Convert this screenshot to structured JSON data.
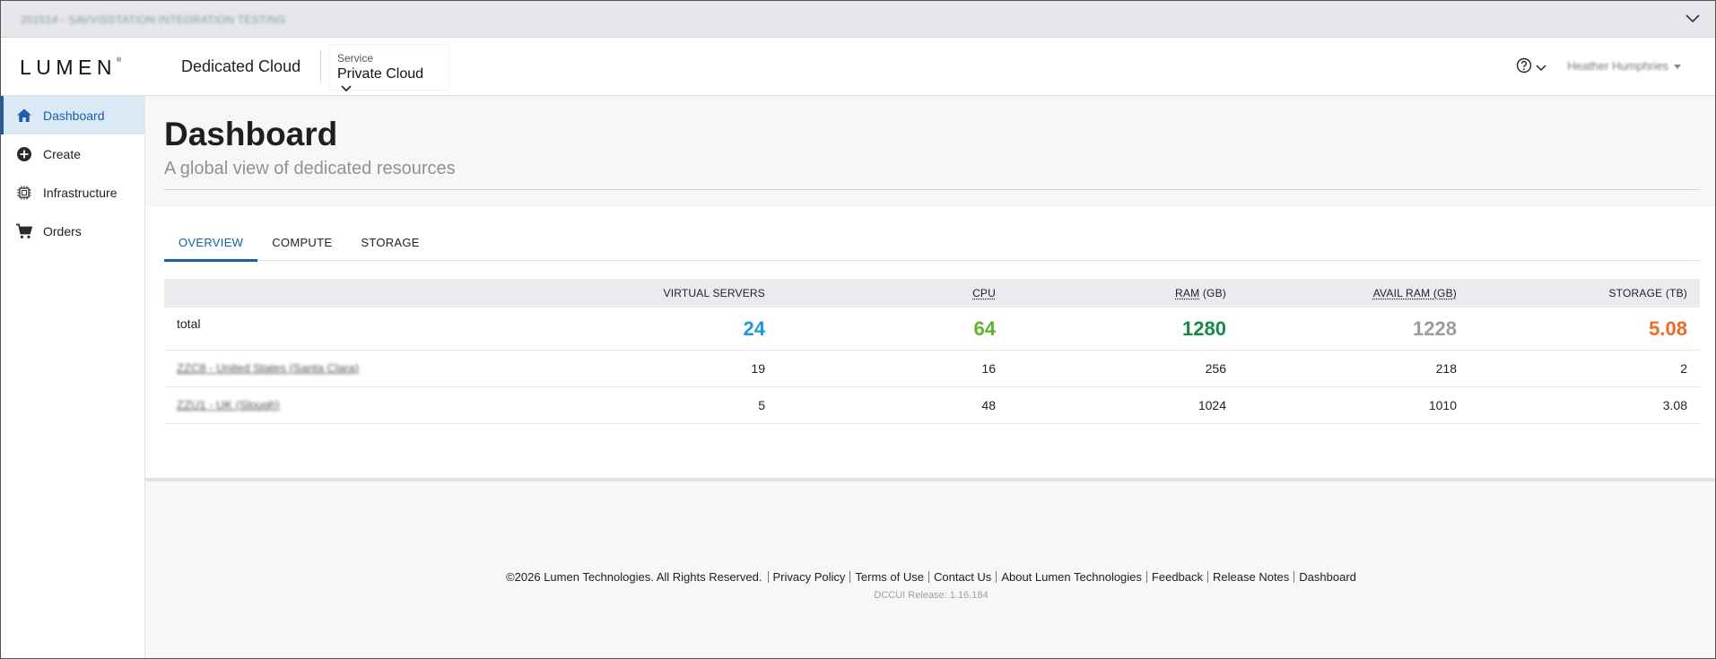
{
  "account_bar": {
    "account_name": "201514 - SAVVISSTATION INTEGRATION TESTING"
  },
  "header": {
    "logo": "LUMEN",
    "logo_mark": "®",
    "product": "Dedicated Cloud",
    "service_label": "Service",
    "service_value": "Private Cloud",
    "user_name": "Heather Humphries"
  },
  "sidebar": {
    "items": [
      {
        "label": "Dashboard",
        "icon": "home-icon",
        "active": true
      },
      {
        "label": "Create",
        "icon": "plus-circle-icon",
        "active": false
      },
      {
        "label": "Infrastructure",
        "icon": "chip-icon",
        "active": false
      },
      {
        "label": "Orders",
        "icon": "cart-icon",
        "active": false
      }
    ]
  },
  "page": {
    "title": "Dashboard",
    "subtitle": "A global view of dedicated resources"
  },
  "tabs": [
    {
      "label": "OVERVIEW",
      "active": true
    },
    {
      "label": "COMPUTE",
      "active": false
    },
    {
      "label": "STORAGE",
      "active": false
    }
  ],
  "table": {
    "headers": {
      "virtual_servers": "VIRTUAL SERVERS",
      "cpu": "CPU",
      "ram_abbr": "RAM",
      "ram_unit": "(GB)",
      "avail_ram_abbr": "AVAIL RAM (GB)",
      "storage": "STORAGE (TB)"
    },
    "total": {
      "label": "total",
      "virtual_servers": "24",
      "cpu": "64",
      "ram": "1280",
      "avail_ram": "1228",
      "storage": "5.08"
    },
    "rows": [
      {
        "site": "ZZC8 - United States (Santa Clara)",
        "virtual_servers": "19",
        "cpu": "16",
        "ram": "256",
        "avail_ram": "218",
        "storage": "2"
      },
      {
        "site": "ZZU1 - UK (Slough)",
        "virtual_servers": "5",
        "cpu": "48",
        "ram": "1024",
        "avail_ram": "1010",
        "storage": "3.08"
      }
    ]
  },
  "colors": {
    "accent": "#1d5ea8",
    "virtual_servers": "#1a9bd7",
    "cpu": "#5db52f",
    "ram": "#138a45",
    "avail_ram": "#9a9ea3",
    "storage": "#ee6b21"
  },
  "footer": {
    "copyright": "©2026 Lumen Technologies. All Rights Reserved.",
    "links": [
      "Privacy Policy",
      "Terms of Use",
      "Contact Us",
      "About Lumen Technologies",
      "Feedback",
      "Release Notes",
      "Dashboard"
    ],
    "release": "DCCUI Release: 1.16.184"
  }
}
